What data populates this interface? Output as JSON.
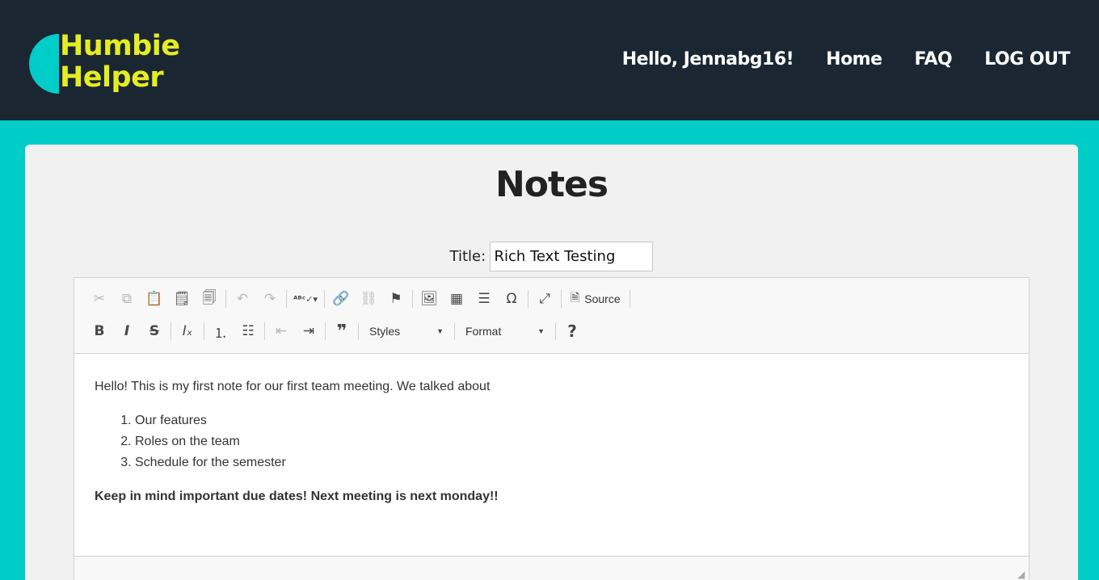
{
  "brand": {
    "line1": "Humbie",
    "line2": "Helper",
    "accent": "#00cdc8",
    "text_color": "#e4ed24"
  },
  "nav": {
    "greeting": "Hello, Jennabg16!",
    "home": "Home",
    "faq": "FAQ",
    "logout": "LOG OUT"
  },
  "page": {
    "title": "Notes"
  },
  "form": {
    "title_label": "Title:",
    "title_value": "Rich Text Testing"
  },
  "toolbar": {
    "row1": [
      "cut-icon",
      "copy-icon",
      "paste-icon",
      "paste-text-icon",
      "paste-word-icon",
      "undo-icon",
      "redo-icon",
      "spellcheck-icon",
      "link-icon",
      "unlink-icon",
      "anchor-icon",
      "image-icon",
      "table-icon",
      "horizontal-line-icon",
      "special-char-icon",
      "maximize-icon",
      "source-icon"
    ],
    "source_label": "Source",
    "styles_label": "Styles",
    "format_label": "Format",
    "row2": [
      "bold-icon",
      "italic-icon",
      "strike-icon",
      "remove-format-icon",
      "numbered-list-icon",
      "bulleted-list-icon",
      "outdent-icon",
      "indent-icon",
      "blockquote-icon",
      "help-icon"
    ]
  },
  "content": {
    "intro": "Hello! This is my first note for our first team meeting. We talked about",
    "items": [
      "Our features",
      "Roles on the team",
      "Schedule for the semester"
    ],
    "closing": "Keep in mind important due dates! Next meeting is next monday!!"
  }
}
